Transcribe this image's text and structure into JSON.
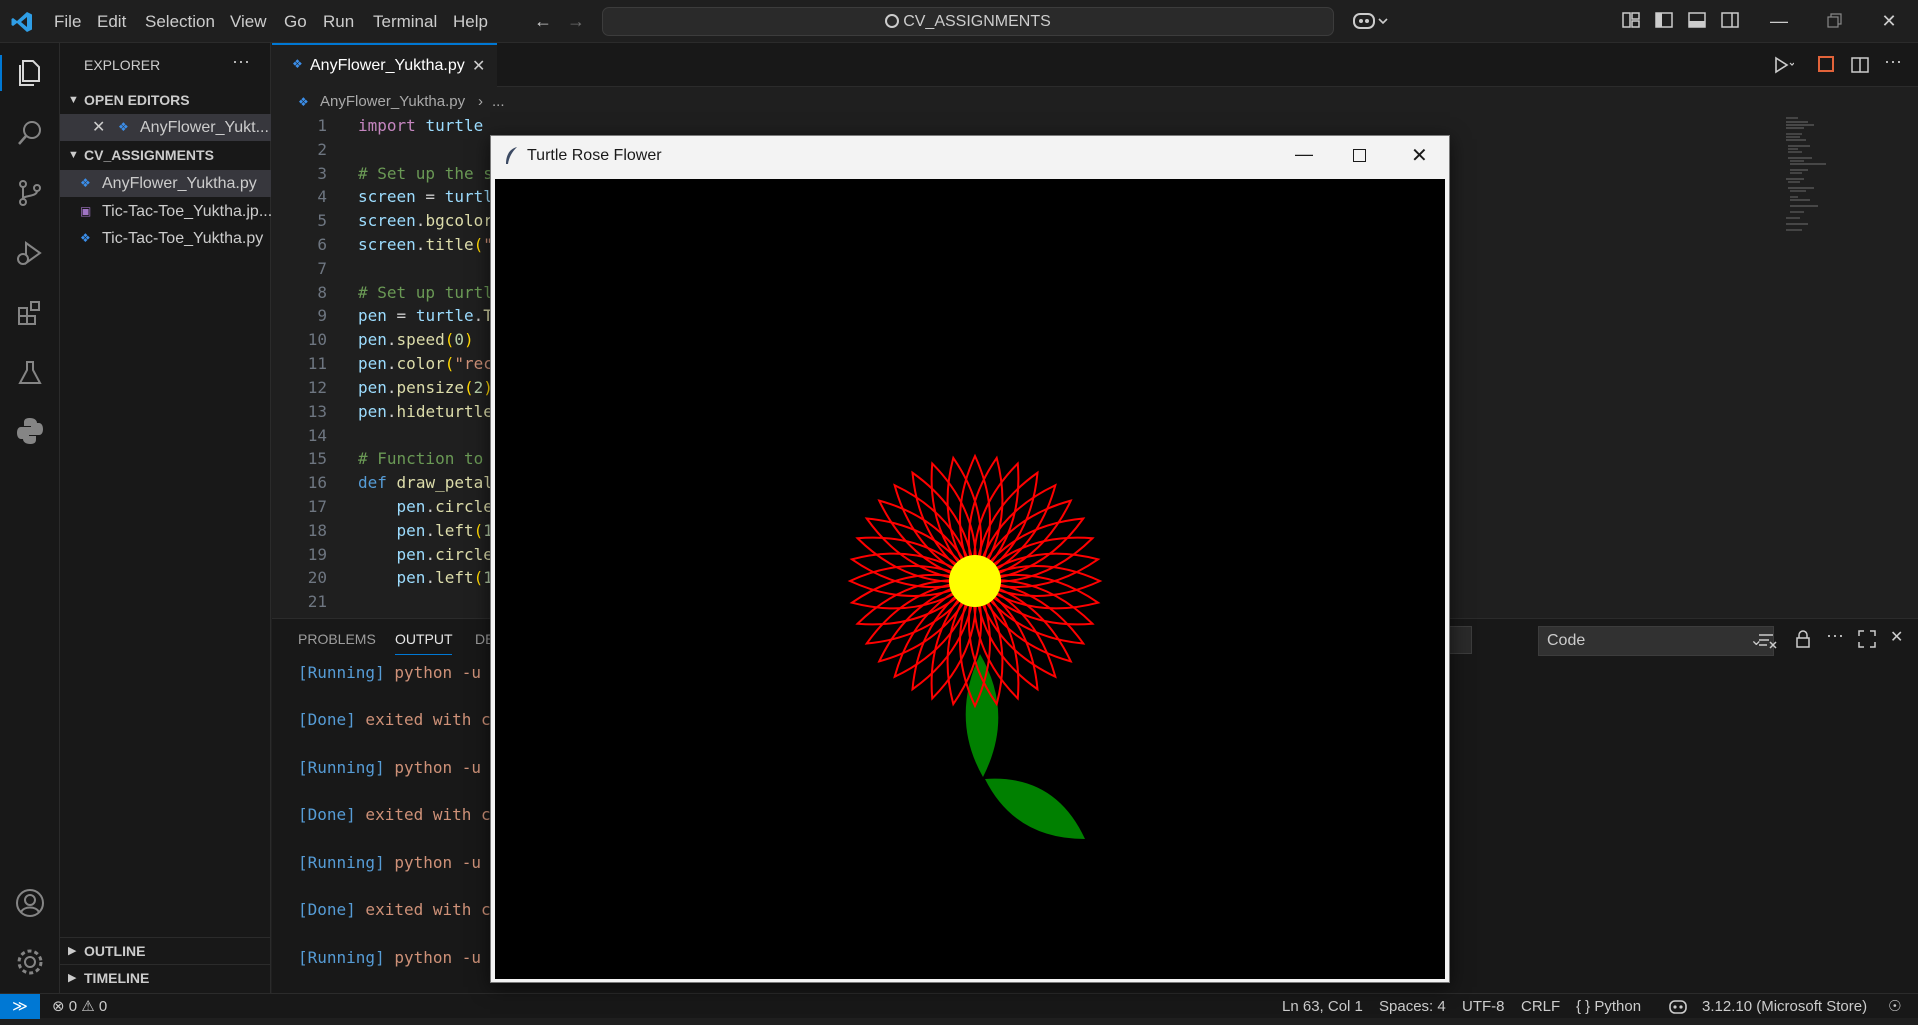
{
  "menu": [
    "File",
    "Edit",
    "Selection",
    "View",
    "Go",
    "Run",
    "Terminal",
    "Help"
  ],
  "search": {
    "text": "CV_ASSIGNMENTS"
  },
  "sidebar": {
    "title": "EXPLORER",
    "open_editors_label": "OPEN EDITORS",
    "open_editors": [
      {
        "name": "AnyFlower_Yukt..."
      }
    ],
    "folder_label": "CV_ASSIGNMENTS",
    "files": [
      {
        "name": "AnyFlower_Yuktha.py",
        "type": "python",
        "selected": true
      },
      {
        "name": "Tic-Tac-Toe_Yuktha.jp...",
        "type": "image",
        "selected": false
      },
      {
        "name": "Tic-Tac-Toe_Yuktha.py",
        "type": "python",
        "selected": false
      }
    ],
    "outline_label": "OUTLINE",
    "timeline_label": "TIMELINE"
  },
  "editor": {
    "tab_label": "AnyFlower_Yuktha.py",
    "breadcrumb_file": "AnyFlower_Yuktha.py",
    "breadcrumb_more": "...",
    "line_numbers": [
      "1",
      "2",
      "3",
      "4",
      "5",
      "6",
      "7",
      "8",
      "9",
      "10",
      "11",
      "12",
      "13",
      "14",
      "15",
      "16",
      "17",
      "18",
      "19",
      "20",
      "21"
    ]
  },
  "panel": {
    "tabs": [
      "PROBLEMS",
      "OUTPUT",
      "DE"
    ],
    "active_tab": "OUTPUT",
    "channel": "Code",
    "lines": [
      {
        "tag": "[Running]",
        "text": " python -u"
      },
      {
        "tag": "[Done]",
        "text": " exited with c"
      },
      {
        "tag": "[Running]",
        "text": " python -u"
      },
      {
        "tag": "[Done]",
        "text": " exited with c"
      },
      {
        "tag": "[Running]",
        "text": " python -u"
      },
      {
        "tag": "[Done]",
        "text": " exited with c"
      },
      {
        "tag": "[Running]",
        "text": " python -u"
      }
    ]
  },
  "turtle_window": {
    "title": "Turtle Rose Flower",
    "petal_color": "#ff0000",
    "center_color": "#ffff00",
    "leaf_color": "#008000",
    "background": "#000000"
  },
  "status": {
    "errors": "0",
    "warnings": "0",
    "position": "Ln 63, Col 1",
    "spaces": "Spaces: 4",
    "encoding": "UTF-8",
    "eol": "CRLF",
    "language": "Python",
    "interpreter": "3.12.10 (Microsoft Store)"
  },
  "colors": {
    "accent": "#0078d4",
    "editor_bg": "#1f1f1f",
    "sidebar_bg": "#181818"
  }
}
